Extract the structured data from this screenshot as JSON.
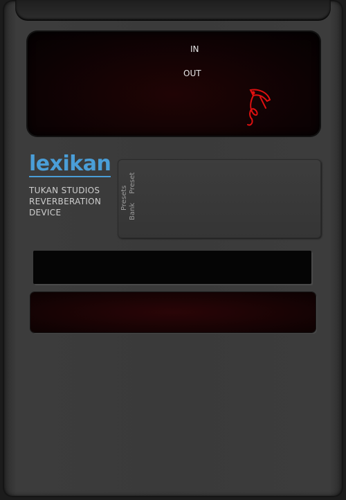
{
  "meter": {
    "in_label": "IN",
    "out_label": "OUT"
  },
  "brand": {
    "name": "lexikan",
    "line1": "TUKAN STUDIOS",
    "line2": "REVERBERATION",
    "line3": "DEVICE"
  },
  "presets": {
    "title": "Presets",
    "bank_label": "Bank",
    "preset_label": "Preset"
  },
  "colors": {
    "brand_blue": "#4a9ed8",
    "logo_red": "#e01010",
    "chassis": "#3a3a3a"
  },
  "icons": [
    "toucan-note-logo-icon"
  ]
}
